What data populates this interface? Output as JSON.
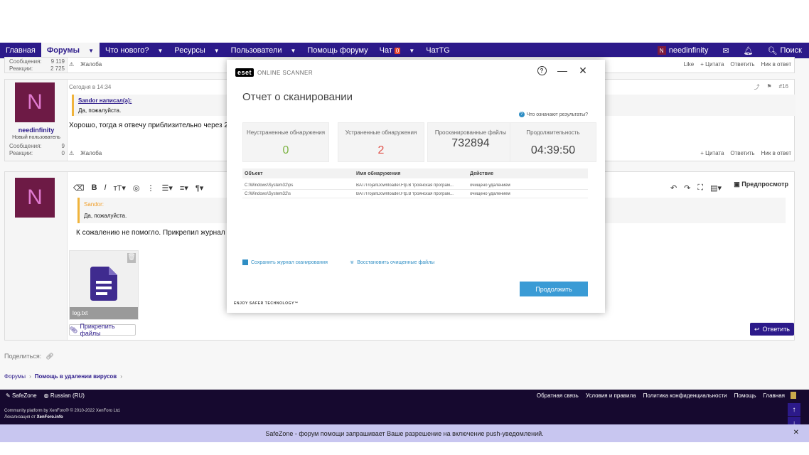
{
  "nav": {
    "items": [
      "Главная",
      "Форумы",
      "Что нового?",
      "Ресурсы",
      "Пользователи",
      "Помощь форуму",
      "Чат",
      "ЧатTG"
    ],
    "chat_badge": "0",
    "username": "needinfinity",
    "avatar_letter": "N",
    "search": "Поиск"
  },
  "post1": {
    "stat_messages_label": "Сообщения:",
    "stat_messages_value": "9 119",
    "stat_reactions_label": "Реакции:",
    "stat_reactions_value": "2 725",
    "report": "Жалоба",
    "actions": [
      "Like",
      "+ Цитата",
      "Ответить",
      "Ник в ответ"
    ]
  },
  "post2": {
    "avatar_letter": "N",
    "username": "needinfinity",
    "role": "Новый пользователь",
    "stat_messages_label": "Сообщения:",
    "stat_messages_value": "9",
    "stat_reactions_label": "Реакции:",
    "stat_reactions_value": "0",
    "time": "Сегодня в 14:34",
    "number": "#16",
    "quote_author": "Sandor написал(а):",
    "quote_text": "Да, пожалуйста.",
    "body": "Хорошо, тогда я отвечу приблизительно через 2.30 ча",
    "report": "Жалоба",
    "actions": [
      "+ Цитата",
      "Ответить",
      "Ник в ответ"
    ]
  },
  "editor": {
    "avatar_letter": "N",
    "preview": "Предпросмотр",
    "quote_author": "Sandor:",
    "quote_text": "Да, пожалуйста.",
    "body": "К сожалению не помогло. Прикрепил журнал скан",
    "file_name": "log.txt",
    "attach": "Прикрепить файлы",
    "reply": "Ответить"
  },
  "share": {
    "label": "Поделиться:"
  },
  "breadcrumb": [
    "Форумы",
    "Помощь в удалении вирусов"
  ],
  "footer": {
    "style": "SafeZone",
    "language": "Russian (RU)",
    "links": [
      "Обратная связь",
      "Условия и правила",
      "Политика конфиденциальности",
      "Помощь",
      "Главная"
    ],
    "copyright": "Community platform by XenForo® © 2010-2022 XenForo Ltd.",
    "localization_label": "Локализация от",
    "localization_name": "XenForo.info"
  },
  "push_notice": "SafeZone - форум помощи запрашивает Ваше разрешение на включение push-уведомлений.",
  "eset": {
    "brand": "eset",
    "product": "ONLINE SCANNER",
    "title": "Отчет о сканировании",
    "help_link": "Что означают результаты?",
    "cards": [
      {
        "label": "Неустраненные обнаружения",
        "value": "0",
        "color": "#7cb342"
      },
      {
        "label": "Устраненные обнаружения",
        "value": "2",
        "color": "#e0524a"
      },
      {
        "label": "Просканированные файлы",
        "value": "732894",
        "color": "#444444"
      },
      {
        "label": "Продолжительность",
        "value": "04:39:50",
        "color": "#444444"
      }
    ],
    "table": {
      "headers": [
        "Объект",
        "Имя обнаружения",
        "Действие"
      ],
      "rows": [
        [
          "C:\\Windows\\System32\\ps",
          "BAT/TrojanDownloader.Ftp.B троянская програм...",
          "очищено удалением"
        ],
        [
          "C:\\Windows\\System32\\s",
          "BAT/TrojanDownloader.Ftp.B троянская програм...",
          "очищено удалением"
        ]
      ]
    },
    "save_log": "Сохранить журнал сканирования",
    "restore": "Восстановить очищенные файлы",
    "continue": "Продолжить",
    "tagline": "ENJOY SAFER TECHNOLOGY™"
  }
}
